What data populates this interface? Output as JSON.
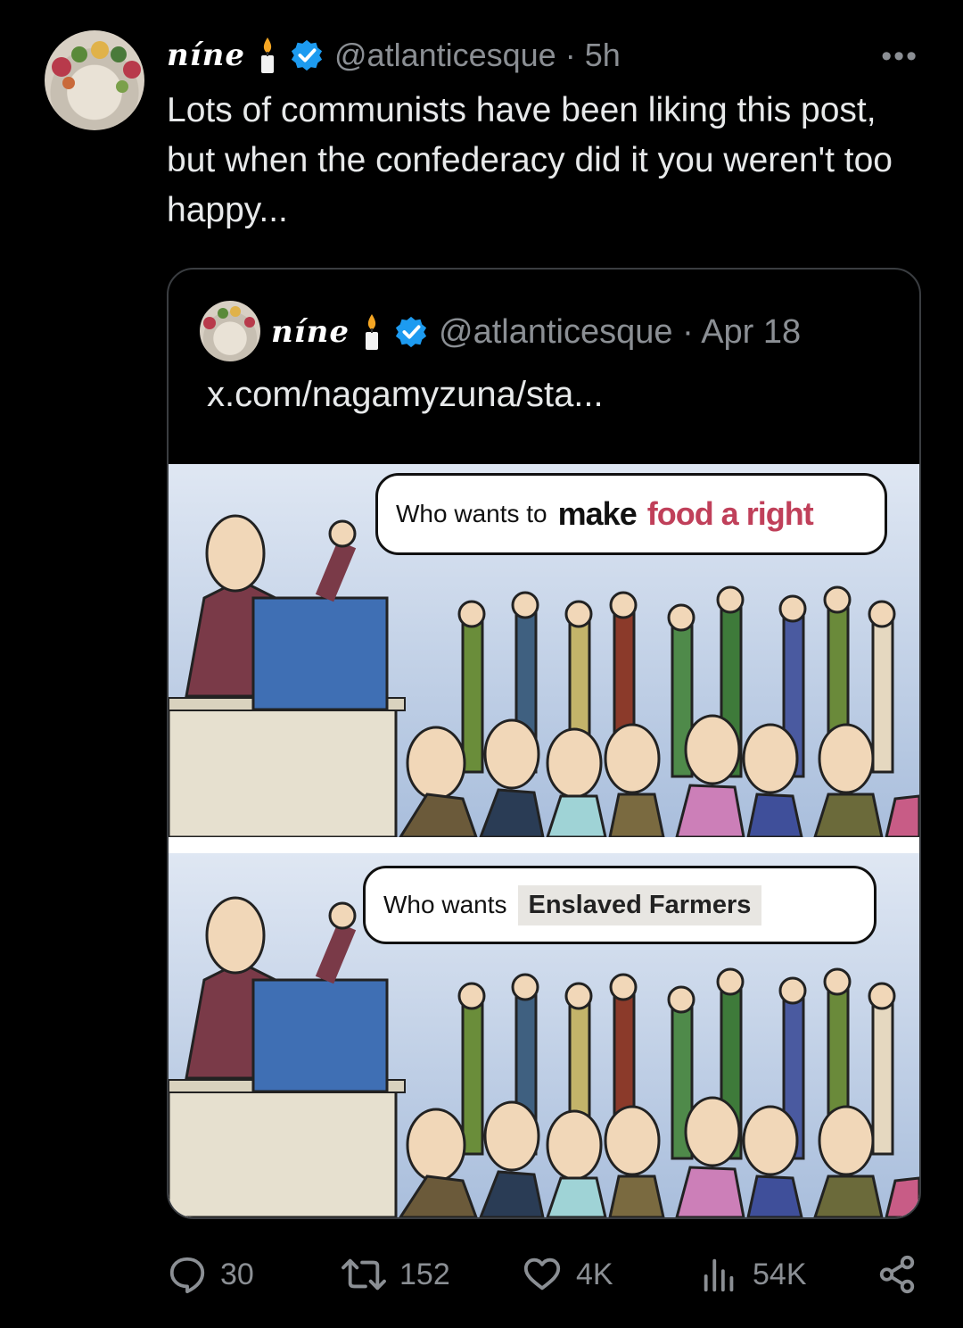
{
  "tweet": {
    "author_name": "níne",
    "handle": "@atlanticesque",
    "time": "5h",
    "text": "Lots of communists have been liking this post, but when the confederacy did it you weren't too happy...",
    "more_label": "•••"
  },
  "quote": {
    "author_name": "níne",
    "handle": "@atlanticesque",
    "date": "Apr 18",
    "link_text": "x.com/nagamyzuna/sta..."
  },
  "meme": {
    "panel1": {
      "pre": "Who wants to",
      "bold1": "make",
      "bold2": "food a right"
    },
    "panel2": {
      "pre": "Who wants",
      "tag": "Enslaved Farmers"
    }
  },
  "actions": {
    "replies": "30",
    "reposts": "152",
    "likes": "4K",
    "views": "54K"
  },
  "colors": {
    "background": "#000000",
    "verified": "#1d9bf0",
    "muted": "#8b8f94",
    "highlight": "#c0405a"
  }
}
